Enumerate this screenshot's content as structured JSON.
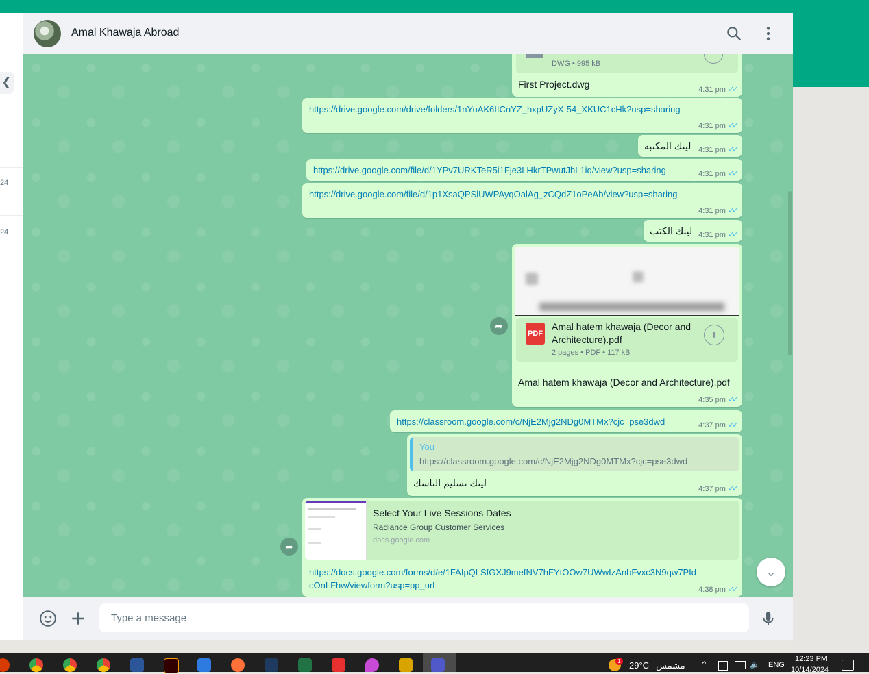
{
  "chat": {
    "contact_name": "Amal Khawaja Abroad",
    "input_placeholder": "Type a message",
    "messages": [
      {
        "file_meta": "DWG • 995 kB",
        "text": "First Project.dwg",
        "time": "4:31 pm"
      },
      {
        "text": "https://drive.google.com/drive/folders/1nYuAK6IICnYZ_hxpUZyX-54_XKUC1cHk?usp=sharing",
        "time": "4:31 pm"
      },
      {
        "text": "لينك المكتبه",
        "time": "4:31 pm"
      },
      {
        "text": "https://drive.google.com/file/d/1YPv7URKTeR5i1Fje3LHkrTPwutJhL1iq/view?usp=sharing",
        "time": "4:31 pm"
      },
      {
        "text": "https://drive.google.com/file/d/1p1XsaQPSlUWPAyqOalAg_zCQdZ1oPeAb/view?usp=sharing",
        "time": "4:31 pm"
      },
      {
        "text": "لينك الكتب",
        "time": "4:31 pm"
      },
      {
        "file_badge": "PDF",
        "file_name": "Amal hatem khawaja (Decor and Architecture).pdf",
        "file_meta": "2 pages • PDF • 117 kB",
        "caption": "Amal hatem khawaja (Decor and Architecture).pdf",
        "time": "4:35 pm"
      },
      {
        "text": "https://classroom.google.com/c/NjE2Mjg2NDg0MTMx?cjc=pse3dwd",
        "time": "4:37 pm"
      },
      {
        "quote_author": "You",
        "quote_text": "https://classroom.google.com/c/NjE2Mjg2NDg0MTMx?cjc=pse3dwd",
        "text": "لينك تسليم التاسك",
        "time": "4:37 pm"
      },
      {
        "preview_title": "Select Your Live Sessions Dates",
        "preview_desc": "Radiance Group Customer Services",
        "preview_domain": "docs.google.com",
        "link_line1": "https://docs.google.com/forms/d/e/1FAIpQLSfGXJ9mefNV7hFYtOOw7UWwIzAnbFvxc3N9qw7PId-",
        "link_line2": "cOnLFhw/viewform?usp=pp_url",
        "time": "4:38 pm"
      }
    ]
  },
  "sidebar_fragments": [
    "24",
    "24"
  ],
  "taskbar": {
    "weather_temp": "29°C",
    "weather_label": "مشمس",
    "weather_badge": "1",
    "language": "ENG",
    "time": "12:23 PM",
    "date": "10/14/2024"
  },
  "colors": {
    "accent": "#00a884",
    "bubble": "#d9fdd3",
    "link": "#027eb5",
    "tick": "#53bdeb",
    "chat_bg": "#7fc9a3"
  }
}
